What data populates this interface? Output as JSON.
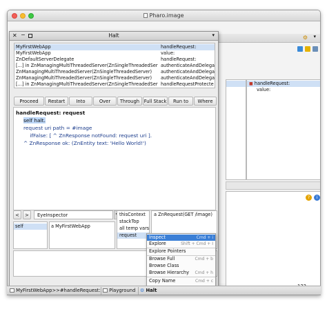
{
  "window": {
    "title": "Pharo.image"
  },
  "playground": {
    "title": "Playground"
  },
  "debugger": {
    "title": "Halt",
    "stack": [
      {
        "receiver": "MyFirstWebApp",
        "method": "handleRequest:"
      },
      {
        "receiver": "MyFirstWebApp",
        "method": "value:"
      },
      {
        "receiver": "ZnDefaultServerDelegate",
        "method": "handleRequest:"
      },
      {
        "receiver": "[...] in ZnManagingMultiThreadedServer(ZnSingleThreadedServer)",
        "method": "authenticateAndDelegat"
      },
      {
        "receiver": "ZnManagingMultiThreadedServer(ZnSingleThreadedServer)",
        "method": "authenticateAndDelegat"
      },
      {
        "receiver": "ZnManagingMultiThreadedServer(ZnSingleThreadedServer)",
        "method": "authenticateAndDelegat"
      },
      {
        "receiver": "[...] in ZnManagingMultiThreadedServer(ZnSingleThreadedServer)",
        "method": "handleRequestProtecte"
      }
    ],
    "buttons": [
      "Proceed",
      "Restart",
      "Into",
      "Over",
      "Through",
      "Full Stack",
      "Run to here",
      "Where is?"
    ],
    "code": {
      "header": "handleRequest: request",
      "lines": [
        "self halt.",
        "request uri path = #image",
        "    ifFalse: [ ^ ZnResponse notFound: request uri ].",
        "^ ZnResponse ok: (ZnEntity text: 'Hello World!')"
      ]
    },
    "inspector_select": "EyeInspector",
    "receiver_field": "self",
    "receiver_value": "a MyFirstWebApp",
    "context_fields": [
      "thisContext",
      "stackTop",
      "all temp vars",
      "request"
    ],
    "context_value": "a ZnRequest(GET /image)"
  },
  "background_browser": {
    "method": "handleRequest:",
    "item": "value:"
  },
  "context_menu": [
    {
      "label": "Inspect",
      "shortcut": "Cmd + i"
    },
    {
      "label": "Explore",
      "shortcut": "Shift + Cmd + I"
    },
    {
      "label": "Explore Pointers",
      "shortcut": ""
    },
    {
      "label": "Browse Full",
      "shortcut": "Cmd + b"
    },
    {
      "label": "Browse Class",
      "shortcut": ""
    },
    {
      "label": "Browse Hierarchy",
      "shortcut": "Cmd + h"
    },
    {
      "label": "Copy Name",
      "shortcut": "Cmd + c"
    }
  ],
  "status_number": "123",
  "taskbar": [
    {
      "label": "MyFirstWebApp>>#handleRequest:"
    },
    {
      "label": "Playground"
    },
    {
      "label": "Halt"
    }
  ]
}
